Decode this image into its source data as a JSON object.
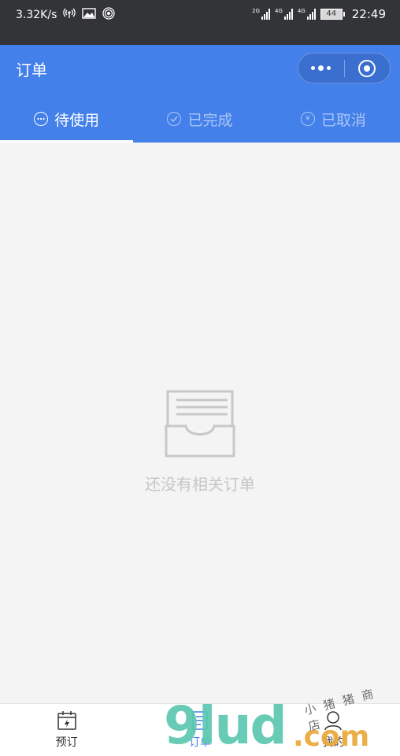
{
  "status_bar": {
    "speed": "3.32K/s",
    "net1_label": "2G",
    "net2_label": "4G",
    "net3_label": "4G",
    "battery": "44",
    "time": "22:49"
  },
  "header": {
    "title": "订单"
  },
  "tabs": [
    {
      "label": "待使用",
      "icon": "more-circle-icon",
      "active": true
    },
    {
      "label": "已完成",
      "icon": "check-circle-icon",
      "active": false
    },
    {
      "label": "已取消",
      "icon": "yen-circle-icon",
      "active": false
    }
  ],
  "empty_state": {
    "icon": "empty-inbox-icon",
    "text": "还没有相关订单"
  },
  "tabbar": [
    {
      "label": "预订",
      "icon": "calendar-icon",
      "active": false
    },
    {
      "label": "订单",
      "icon": "order-list-icon",
      "active": true
    },
    {
      "label": "我的",
      "icon": "profile-icon",
      "active": false
    }
  ],
  "watermark": {
    "brand": "9lud",
    "tld": ".com",
    "cn": "小猪猪商店"
  },
  "colors": {
    "accent": "#4480ea",
    "status_bar": "#333438",
    "background": "#f4f4f4"
  }
}
